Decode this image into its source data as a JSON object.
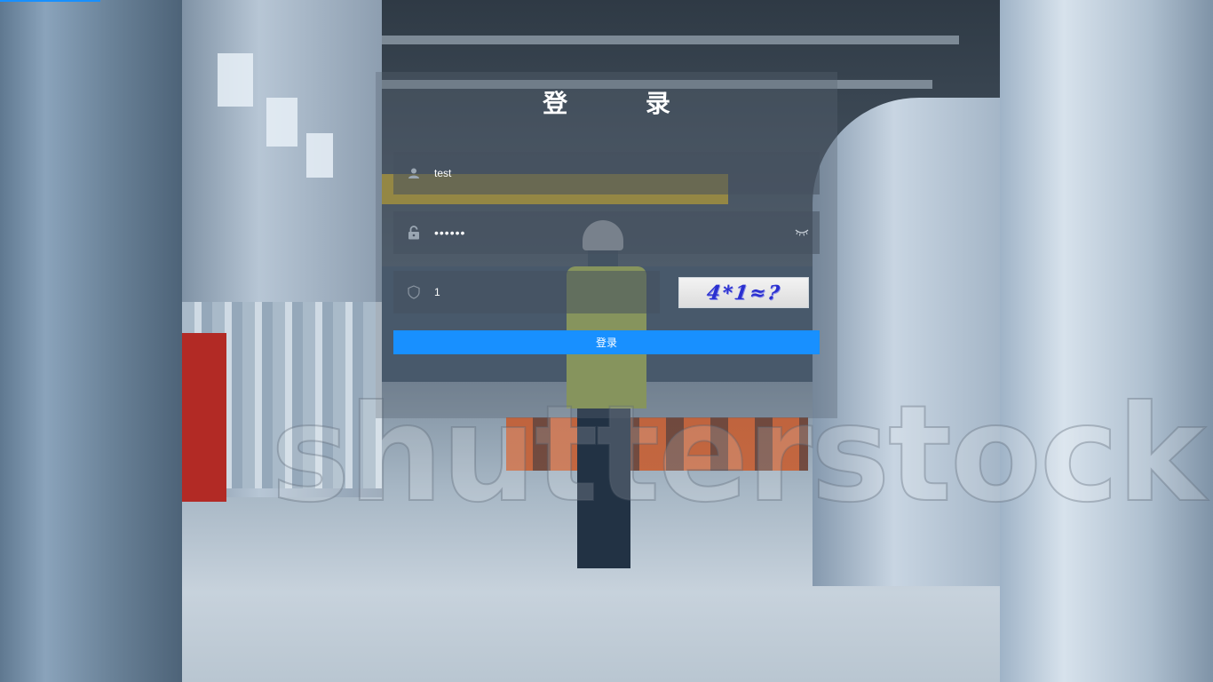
{
  "login": {
    "title": "登 录",
    "username": {
      "value": "test",
      "icon": "user-icon"
    },
    "password": {
      "value": "••••••",
      "icon": "lock-icon",
      "toggle_icon": "eye-closed-icon"
    },
    "captcha": {
      "value": "1",
      "icon": "shield-icon",
      "image_text": "4*1≈?"
    },
    "submit_label": "登录"
  },
  "background": {
    "watermark": "shutterstock"
  },
  "colors": {
    "accent": "#1890ff",
    "panel": "rgba(90,100,115,0.35)"
  }
}
